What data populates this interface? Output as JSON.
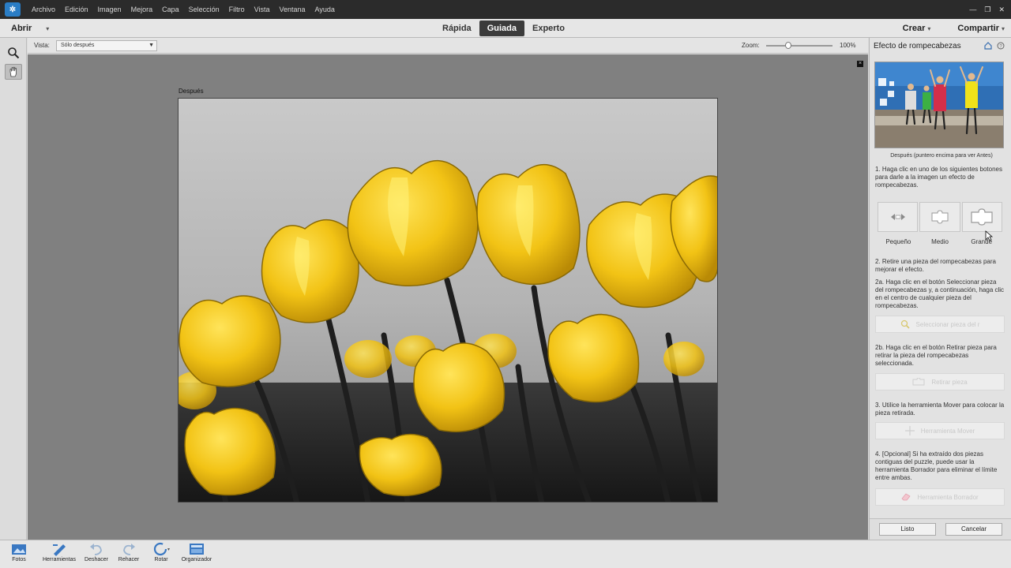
{
  "menubar": {
    "items": [
      "Archivo",
      "Edición",
      "Imagen",
      "Mejora",
      "Capa",
      "Selección",
      "Filtro",
      "Vista",
      "Ventana",
      "Ayuda"
    ]
  },
  "modebar": {
    "open_label": "Abrir",
    "tabs": [
      "Rápida",
      "Guiada",
      "Experto"
    ],
    "active_tab": "Guiada",
    "create_label": "Crear",
    "share_label": "Compartir"
  },
  "options": {
    "vista_label": "Vista:",
    "vista_value": "Sólo después",
    "zoom_label": "Zoom:",
    "zoom_value": "100%",
    "zoom_level": 0.33
  },
  "canvas": {
    "image_label": "Después"
  },
  "panel": {
    "title": "Efecto de rompecabezas",
    "preview_caption": "Después (puntero encima para ver Antes)",
    "step1": "1. Haga clic en uno de los siguientes botones para darle a la imagen un efecto de rompecabezas.",
    "sizes": [
      "Pequeño",
      "Medio",
      "Grande"
    ],
    "step2": "2. Retire una pieza del rompecabezas para mejorar el efecto.",
    "step2a": "2a. Haga clic en el botón Seleccionar pieza del rompecabezas y, a continuación, haga clic en el centro de cualquier pieza del rompecabezas.",
    "select_piece_btn": "Seleccionar pieza del r",
    "step2b": "2b. Haga clic en el botón Retirar pieza para retirar la pieza del rompecabezas seleccionada.",
    "remove_piece_btn": "Retirar pieza",
    "step3": "3. Utilice la herramienta Mover para colocar la pieza retirada.",
    "move_tool_btn": "Herramienta Mover",
    "step4": "4. [Opcional] Si ha extraído dos piezas contiguas del puzzle, puede usar la herramienta Borrador para eliminar el límite entre ambas.",
    "eraser_tool_btn": "Herramienta Borrador",
    "done_label": "Listo",
    "cancel_label": "Cancelar"
  },
  "bottombar": {
    "items": [
      "Fotos",
      "Herramientas",
      "Deshacer",
      "Rehacer",
      "Rotar",
      "Organizador"
    ]
  },
  "colors": {
    "accent_tab": "#3b3b3b",
    "tulip_yellow": "#f2c315",
    "canvas_bg": "#808080"
  }
}
